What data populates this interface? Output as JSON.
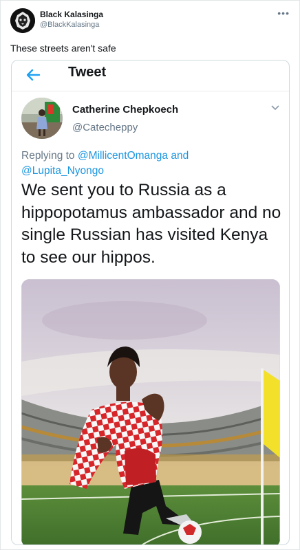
{
  "outer_tweet": {
    "display_name": "Black Kalasinga",
    "handle": "@BlackKalasinga",
    "more_label": "•••",
    "text": "These streets aren't safe"
  },
  "embedded": {
    "header_title": "Tweet",
    "display_name": "Catherine Chepkoech",
    "handle": "@Catecheppy",
    "replying_prefix": "Replying to",
    "mention_1": "@MillicentOmanga",
    "replying_join": "and",
    "mention_2": "@Lupita_Nyongo",
    "text": "We sent you to Russia as a hippopotamus ambassador and no single Russian has visited Kenya to see our hippos."
  },
  "colors": {
    "link": "#1b95e0",
    "muted": "#657786",
    "text": "#14171a",
    "border": "#cfd9de"
  },
  "icons": {
    "back": "left-arrow-icon",
    "caret": "chevron-down-icon",
    "more": "more-dots-icon"
  }
}
